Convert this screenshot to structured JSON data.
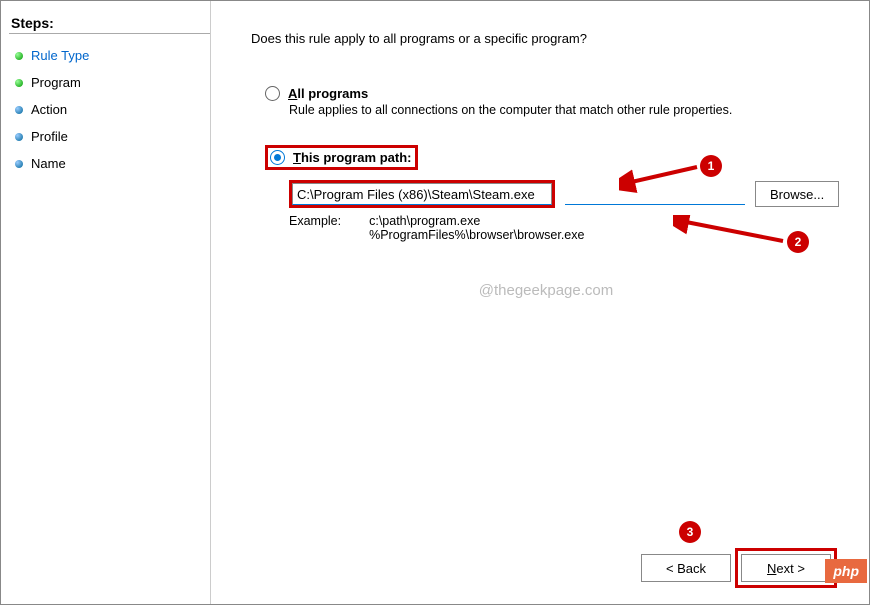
{
  "sidebar": {
    "title": "Steps:",
    "items": [
      {
        "label": "Rule Type",
        "current": true
      },
      {
        "label": "Program"
      },
      {
        "label": "Action"
      },
      {
        "label": "Profile"
      },
      {
        "label": "Name"
      }
    ]
  },
  "main": {
    "question": "Does this rule apply to all programs or a specific program?",
    "radio_all": {
      "label": "All programs",
      "sub": "Rule applies to all connections on the computer that match other rule properties."
    },
    "radio_this": {
      "label": "This program path:"
    },
    "path_value": "C:\\Program Files (x86)\\Steam\\Steam.exe",
    "browse_label": "Browse...",
    "example_label": "Example:",
    "example_value": "c:\\path\\program.exe\n%ProgramFiles%\\browser\\browser.exe",
    "watermark": "@thegeekpage.com"
  },
  "footer": {
    "back": "< Back",
    "next": "Next >"
  },
  "badges": {
    "php": "php"
  },
  "annotations": {
    "n1": "1",
    "n2": "2",
    "n3": "3"
  }
}
